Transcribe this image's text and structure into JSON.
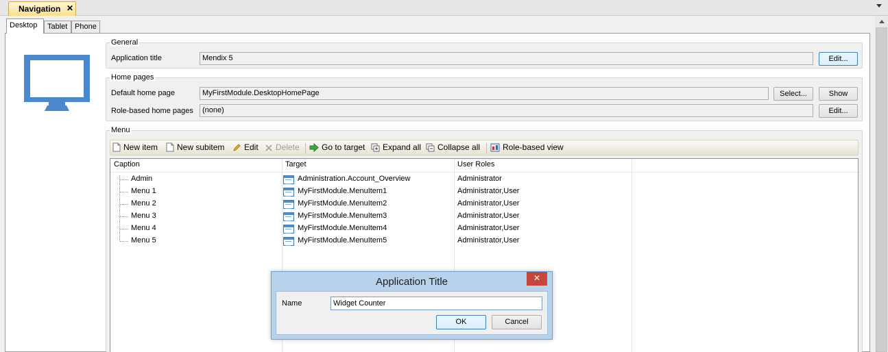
{
  "document_tab": {
    "label": "Navigation",
    "close_glyph": "✕"
  },
  "device_tabs": [
    "Desktop",
    "Tablet",
    "Phone"
  ],
  "general": {
    "legend": "General",
    "app_title_label": "Application title",
    "app_title_value": "Mendix 5",
    "edit_label": "Edit..."
  },
  "home_pages": {
    "legend": "Home pages",
    "default_label": "Default home page",
    "default_value": "MyFirstModule.DesktopHomePage",
    "select_label": "Select...",
    "show_label": "Show",
    "role_label": "Role-based home pages",
    "role_value": "(none)",
    "edit_label": "Edit..."
  },
  "menu": {
    "legend": "Menu",
    "toolbar": {
      "new_item": "New item",
      "new_subitem": "New subitem",
      "edit": "Edit",
      "delete": "Delete",
      "go_to_target": "Go to target",
      "expand_all": "Expand all",
      "collapse_all": "Collapse all",
      "role_based_view": "Role-based view"
    },
    "columns": [
      "Caption",
      "Target",
      "User Roles"
    ],
    "rows": [
      {
        "caption": "Admin",
        "target": "Administration.Account_Overview",
        "roles": "Administrator"
      },
      {
        "caption": "Menu 1",
        "target": "MyFirstModule.MenuItem1",
        "roles": "Administrator,User"
      },
      {
        "caption": "Menu 2",
        "target": "MyFirstModule.MenuItem2",
        "roles": "Administrator,User"
      },
      {
        "caption": "Menu 3",
        "target": "MyFirstModule.MenuItem3",
        "roles": "Administrator,User"
      },
      {
        "caption": "Menu 4",
        "target": "MyFirstModule.MenuItem4",
        "roles": "Administrator,User"
      },
      {
        "caption": "Menu 5",
        "target": "MyFirstModule.MenuItem5",
        "roles": "Administrator,User"
      }
    ]
  },
  "dialog": {
    "title": "Application Title",
    "close_glyph": "✕",
    "name_label": "Name",
    "name_value": "Widget Counter",
    "ok_label": "OK",
    "cancel_label": "Cancel"
  },
  "colors": {
    "monitor_blue": "#4a87cc",
    "tab_gold": "#f9df8c",
    "dialog_frame": "#b8d2ec",
    "close_red": "#c7463c"
  }
}
